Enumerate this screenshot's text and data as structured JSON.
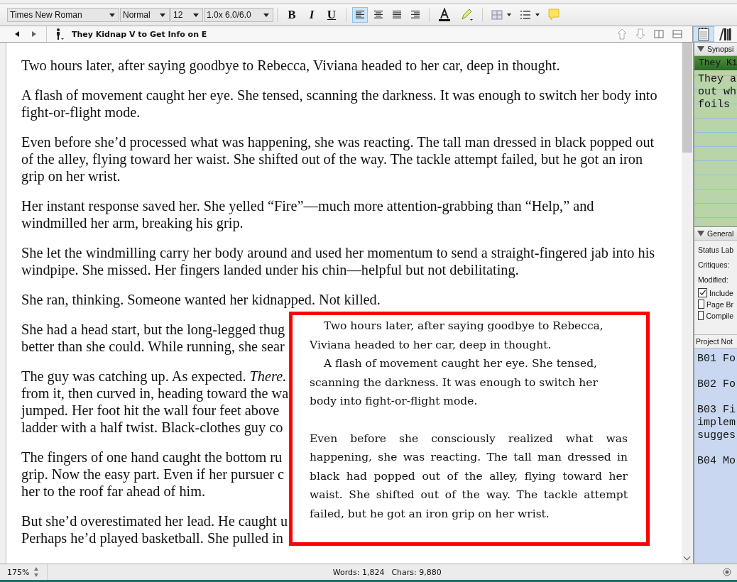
{
  "format_bar": {
    "selects": [
      "Times New Roman",
      "Normal",
      "12",
      "1.0x 6.0/6.0"
    ],
    "styles": [
      {
        "kind": "bold",
        "label": "B"
      },
      {
        "kind": "italic",
        "label": "I"
      },
      {
        "kind": "underline",
        "label": "U"
      }
    ],
    "alignments": [
      {
        "kind": "left",
        "selected": true
      },
      {
        "kind": "center",
        "selected": false
      },
      {
        "kind": "justify",
        "selected": false
      },
      {
        "kind": "right",
        "selected": false
      }
    ]
  },
  "header_bar": {
    "title": "They Kidnap V to Get Info on E",
    "inspector_tabs": [
      {
        "kind": "notes",
        "selected": true
      },
      {
        "kind": "books",
        "selected": false
      }
    ]
  },
  "editor": {
    "paragraphs": [
      {
        "lines": [
          "Two hours later, after saying goodbye to Rebecca, Viviana headed to her car, deep in thought."
        ]
      },
      {
        "lines": [
          "A flash of movement caught her eye. She tensed, scanning the darkness. It was enough to switch her body into",
          "fight-or-flight mode."
        ]
      },
      {
        "lines": [
          "Even before she’d processed what was happening, she was reacting. The tall man dressed in black popped out",
          "of the alley, flying toward her waist. She shifted out of the way. The tackle attempt failed, but he got an iron",
          "grip on her wrist."
        ]
      },
      {
        "lines": [
          "Her instant response saved her. She yelled “Fire”—much more attention-grabbing than “Help,” and",
          "windmilled her arm, breaking his grip."
        ]
      },
      {
        "lines": [
          "She let the windmilling carry her body around and used her momentum to send a straight-fingered jab into his",
          "windpipe. She missed. Her fingers landed under his chin—helpful but not debilitating."
        ]
      },
      {
        "lines": [
          "She ran, thinking. Someone wanted her kidnapped. Not killed."
        ]
      },
      {
        "lines": [
          "She had a head start, but the long-legged thug",
          "better than she could. While running, she sear"
        ]
      },
      {
        "lines": [
          "The guy was catching up. As expected. *There.*",
          "from it, then curved in, heading toward the wa",
          "jumped. Her foot hit the wall four feet above",
          "ladder with a half twist. Black-clothes guy co"
        ]
      },
      {
        "lines": [
          "The fingers of one hand caught the bottom ru",
          "grip. Now the easy part. Even if her pursuer c",
          "her to the roof far ahead of him."
        ]
      },
      {
        "lines": [
          "But she’d overestimated her lead. He caught u",
          "Perhaps he’d played basketball. She pulled in"
        ]
      }
    ]
  },
  "preview": {
    "paragraphs": [
      {
        "kind": "indented",
        "text": "Two hours later, after saying goodbye to Rebecca, Viviana headed to her car, deep in thought."
      },
      {
        "kind": "indented",
        "text": "A flash of movement caught her eye. She tensed, scanning the darkness. It was enough to switch her body into fight-or-flight mode."
      },
      {
        "kind": "justified",
        "text": "Even before she consciously realized what was happening, she was reacting. The tall man dressed in black had popped out of the alley, flying toward her waist. She shifted out of the way. The tackle attempt failed, but he got an iron grip on her wrist."
      }
    ]
  },
  "inspector": {
    "synopsis": {
      "header": "Synopsi",
      "title": "They Ki",
      "lines": [
        "They a",
        "out wh",
        "foils"
      ]
    },
    "general": {
      "header": "General",
      "labels": [
        "Status Lab",
        "Critiques:",
        "Modified:"
      ],
      "checks": [
        {
          "label": "Include",
          "checked": true
        },
        {
          "label": "Page Br",
          "checked": false
        },
        {
          "label": "Compile",
          "checked": false
        }
      ]
    },
    "notes": {
      "header": "Project Not",
      "items": [
        {
          "lines": [
            "B01 Fo"
          ]
        },
        {
          "lines": [
            "B02 Fo"
          ]
        },
        {
          "lines": [
            "B03 Fi",
            "implem",
            "sugges"
          ]
        },
        {
          "lines": [
            "B04 Mo"
          ]
        }
      ]
    }
  },
  "status_bar": {
    "zoom": "175%",
    "words": "Words: 1,824",
    "chars": "Chars: 9,880"
  }
}
